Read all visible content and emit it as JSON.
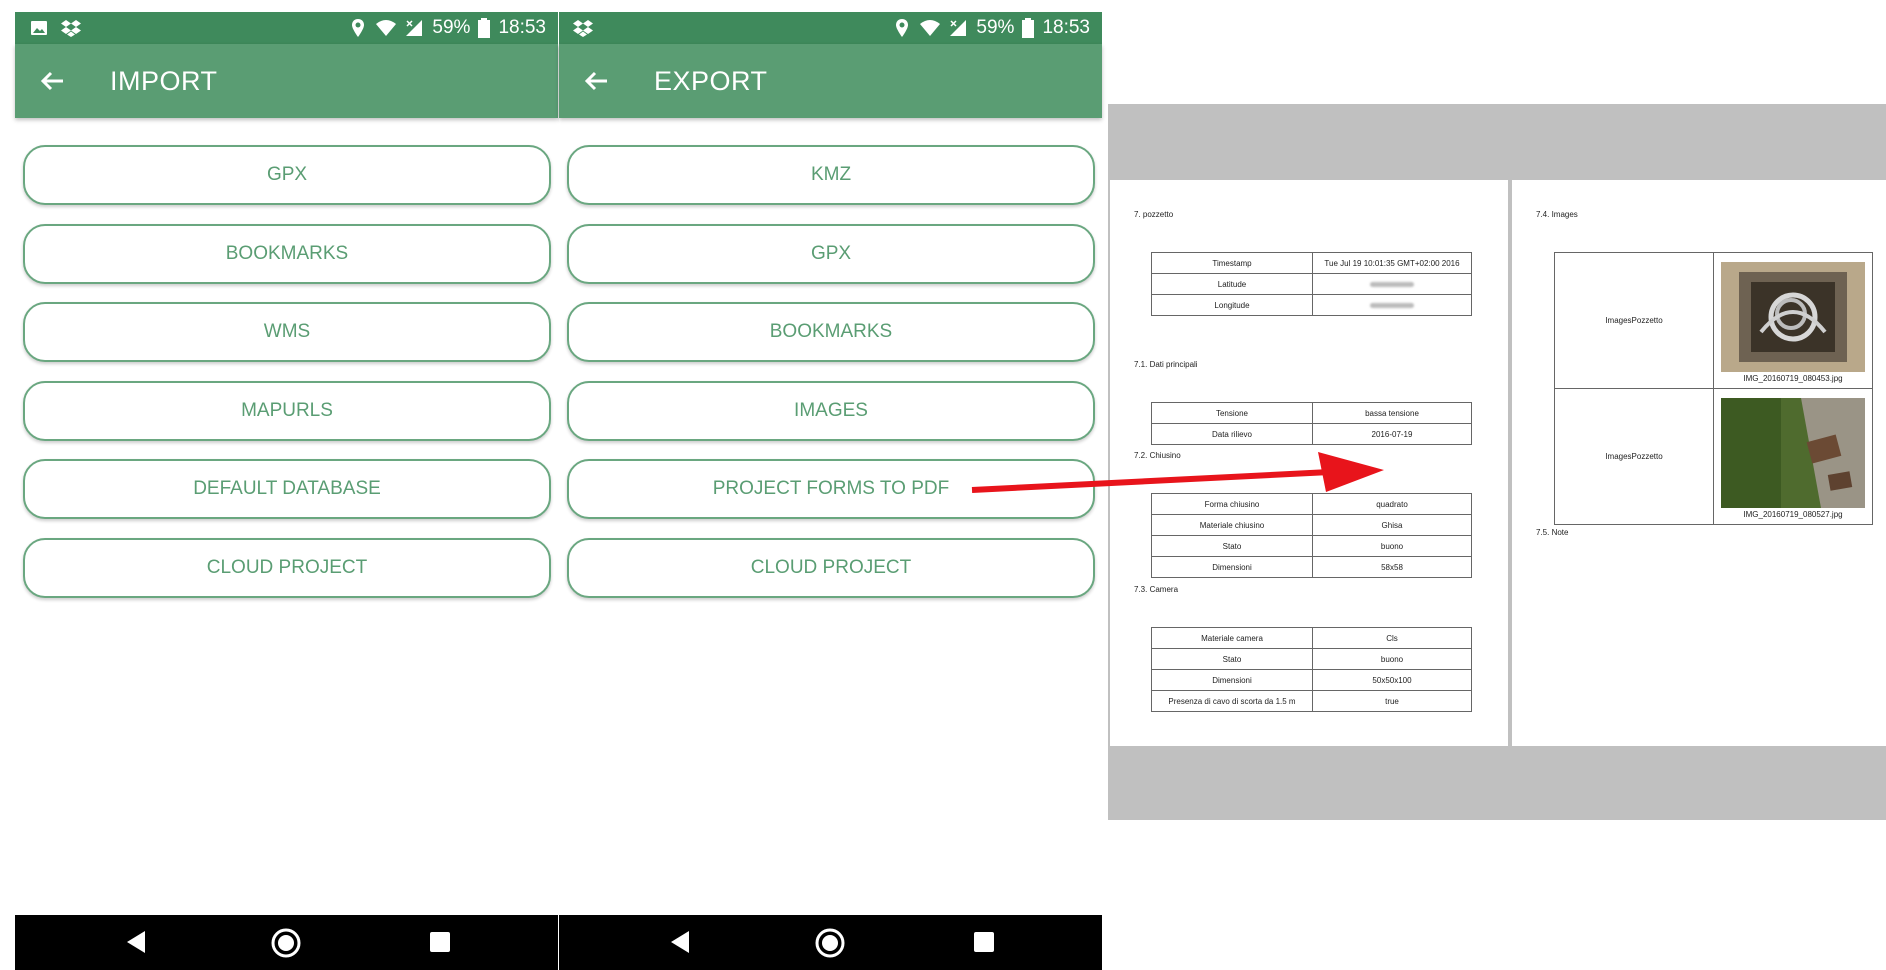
{
  "status_bar": {
    "battery": "59%",
    "time": "18:53"
  },
  "import_screen": {
    "title": "IMPORT",
    "buttons": [
      "GPX",
      "BOOKMARKS",
      "WMS",
      "MAPURLS",
      "DEFAULT DATABASE",
      "CLOUD PROJECT"
    ]
  },
  "export_screen": {
    "title": "EXPORT",
    "buttons": [
      "KMZ",
      "GPX",
      "BOOKMARKS",
      "IMAGES",
      "PROJECT FORMS TO PDF",
      "CLOUD PROJECT"
    ]
  },
  "colors": {
    "status_bar": "#3f8a5c",
    "app_bar": "#5a9d73",
    "button_text": "#5a9d73",
    "button_border": "#6aa780",
    "arrow": "#e8141b",
    "pdf_background": "#c0c0c0"
  },
  "icons": [
    "image-icon",
    "dropbox-icon",
    "location-icon",
    "wifi-icon",
    "signal-icon",
    "battery-icon",
    "back-arrow-icon",
    "nav-back-icon",
    "nav-home-icon",
    "nav-recents-icon"
  ],
  "pdf": {
    "page1": {
      "heading": "7. pozzetto",
      "table_main": [
        {
          "key": "Timestamp",
          "value": "Tue Jul 19 10:01:35 GMT+02:00 2016"
        },
        {
          "key": "Latitude",
          "value": ""
        },
        {
          "key": "Longitude",
          "value": ""
        }
      ],
      "s1_title": "7.1. Dati principali",
      "s1_rows": [
        {
          "key": "Tensione",
          "value": "bassa tensione"
        },
        {
          "key": "Data rilievo",
          "value": "2016-07-19"
        }
      ],
      "s2_title": "7.2. Chiusino",
      "s2_rows": [
        {
          "key": "Forma chiusino",
          "value": "quadrato"
        },
        {
          "key": "Materiale chiusino",
          "value": "Ghisa"
        },
        {
          "key": "Stato",
          "value": "buono"
        },
        {
          "key": "Dimensioni",
          "value": "58x58"
        }
      ],
      "s3_title": "7.3. Camera",
      "s3_rows": [
        {
          "key": "Materiale camera",
          "value": "Cls"
        },
        {
          "key": "Stato",
          "value": "buono"
        },
        {
          "key": "Dimensioni",
          "value": "50x50x100"
        },
        {
          "key": "Presenza di cavo di scorta da 1.5 m",
          "value": "true"
        }
      ]
    },
    "page2": {
      "s4_title": "7.4. Images",
      "images": [
        {
          "label": "ImagesPozzetto",
          "caption": "IMG_20160719_080453.jpg"
        },
        {
          "label": "ImagesPozzetto",
          "caption": "IMG_20160719_080527.jpg"
        }
      ],
      "s5_title": "7.5. Note"
    }
  }
}
